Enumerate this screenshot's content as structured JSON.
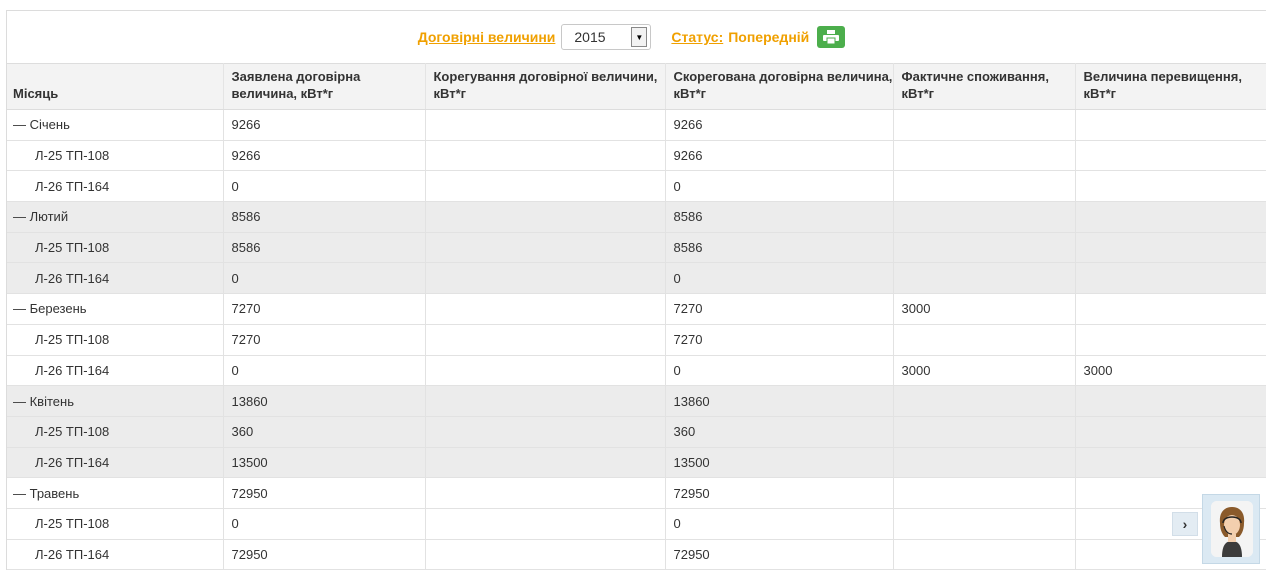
{
  "toolbar": {
    "contract_link": "Договірні величини",
    "year": "2015",
    "status_label": "Статус:",
    "status_value": "Попередній",
    "print_icon": "printer-icon"
  },
  "table": {
    "headers": [
      "Місяць",
      "Заявлена договірна величина, кВт*г",
      "Корегування договірної величини, кВт*г",
      "Скорегована договірна величина, кВт*г",
      "Фактичне споживання, кВт*г",
      "Величина перевищення, кВт*г"
    ],
    "rows": [
      {
        "cells": [
          "— Січень",
          "9266",
          "",
          "9266",
          "",
          ""
        ]
      },
      {
        "cells": [
          "Л-25 ТП-108",
          "9266",
          "",
          "9266",
          "",
          ""
        ]
      },
      {
        "cells": [
          "Л-26 ТП-164",
          "0",
          "",
          "0",
          "",
          ""
        ]
      },
      {
        "cells": [
          "— Лютий",
          "8586",
          "",
          "8586",
          "",
          ""
        ]
      },
      {
        "cells": [
          "Л-25 ТП-108",
          "8586",
          "",
          "8586",
          "",
          ""
        ]
      },
      {
        "cells": [
          "Л-26 ТП-164",
          "0",
          "",
          "0",
          "",
          ""
        ]
      },
      {
        "cells": [
          "— Березень",
          "7270",
          "",
          "7270",
          "3000",
          ""
        ]
      },
      {
        "cells": [
          "Л-25 ТП-108",
          "7270",
          "",
          "7270",
          "",
          ""
        ]
      },
      {
        "cells": [
          "Л-26 ТП-164",
          "0",
          "",
          "0",
          "3000",
          "3000"
        ]
      },
      {
        "cells": [
          "— Квітень",
          "13860",
          "",
          "13860",
          "",
          ""
        ]
      },
      {
        "cells": [
          "Л-25 ТП-108",
          "360",
          "",
          "360",
          "",
          ""
        ]
      },
      {
        "cells": [
          "Л-26 ТП-164",
          "13500",
          "",
          "13500",
          "",
          ""
        ]
      },
      {
        "cells": [
          "— Травень",
          "72950",
          "",
          "72950",
          "",
          ""
        ]
      },
      {
        "cells": [
          "Л-25 ТП-108",
          "0",
          "",
          "0",
          "",
          ""
        ]
      },
      {
        "cells": [
          "Л-26 ТП-164",
          "72950",
          "",
          "72950",
          "",
          ""
        ]
      }
    ]
  },
  "chat": {
    "toggle_icon": "chevron-right-icon",
    "avatar_icon": "support-agent-avatar"
  },
  "colors": {
    "accent": "#f0a000",
    "print_button": "#4cae4c",
    "header_bg": "#f3f3f3",
    "month_row_bg": "#ececec"
  }
}
